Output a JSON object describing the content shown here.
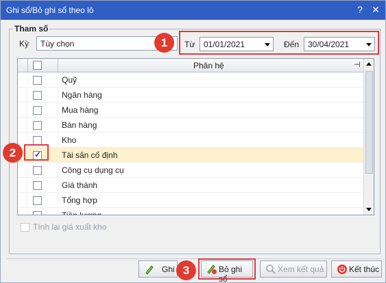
{
  "window": {
    "title": "Ghi sổ/Bỏ ghi sổ theo lô",
    "help_glyph": "?",
    "close_glyph": "✕"
  },
  "params": {
    "group_title": "Tham số",
    "ky_label": "Kỳ",
    "ky_value": "Tùy chọn",
    "tu_label": "Từ",
    "tu_value": "01/01/2021",
    "den_label": "Đến",
    "den_value": "30/04/2021"
  },
  "grid": {
    "header": "Phân hệ",
    "rows": [
      {
        "label": "Quỹ",
        "checked": false
      },
      {
        "label": "Ngân hàng",
        "checked": false
      },
      {
        "label": "Mua hàng",
        "checked": false
      },
      {
        "label": "Bán hàng",
        "checked": false
      },
      {
        "label": "Kho",
        "checked": false
      },
      {
        "label": "Tài sản cố định",
        "checked": true
      },
      {
        "label": "Công cụ dụng cụ",
        "checked": false
      },
      {
        "label": "Giá thành",
        "checked": false
      },
      {
        "label": "Tổng hợp",
        "checked": false
      },
      {
        "label": "Tiền lương",
        "checked": false
      }
    ]
  },
  "options": {
    "recalc_label": "Tính lại giá xuất kho"
  },
  "buttons": {
    "ghi": "Ghi",
    "bo_ghi_so": "Bỏ ghi sổ",
    "xem_ket_qua": "Xem kết quả",
    "ket_thuc": "Kết thúc"
  },
  "badges": {
    "b1": "1",
    "b2": "2",
    "b3": "3"
  },
  "colors": {
    "title_bar": "#2f5ec4",
    "highlight": "#e0393e",
    "badge": "#e23a2e",
    "selected_row": "#fdf0cd"
  }
}
